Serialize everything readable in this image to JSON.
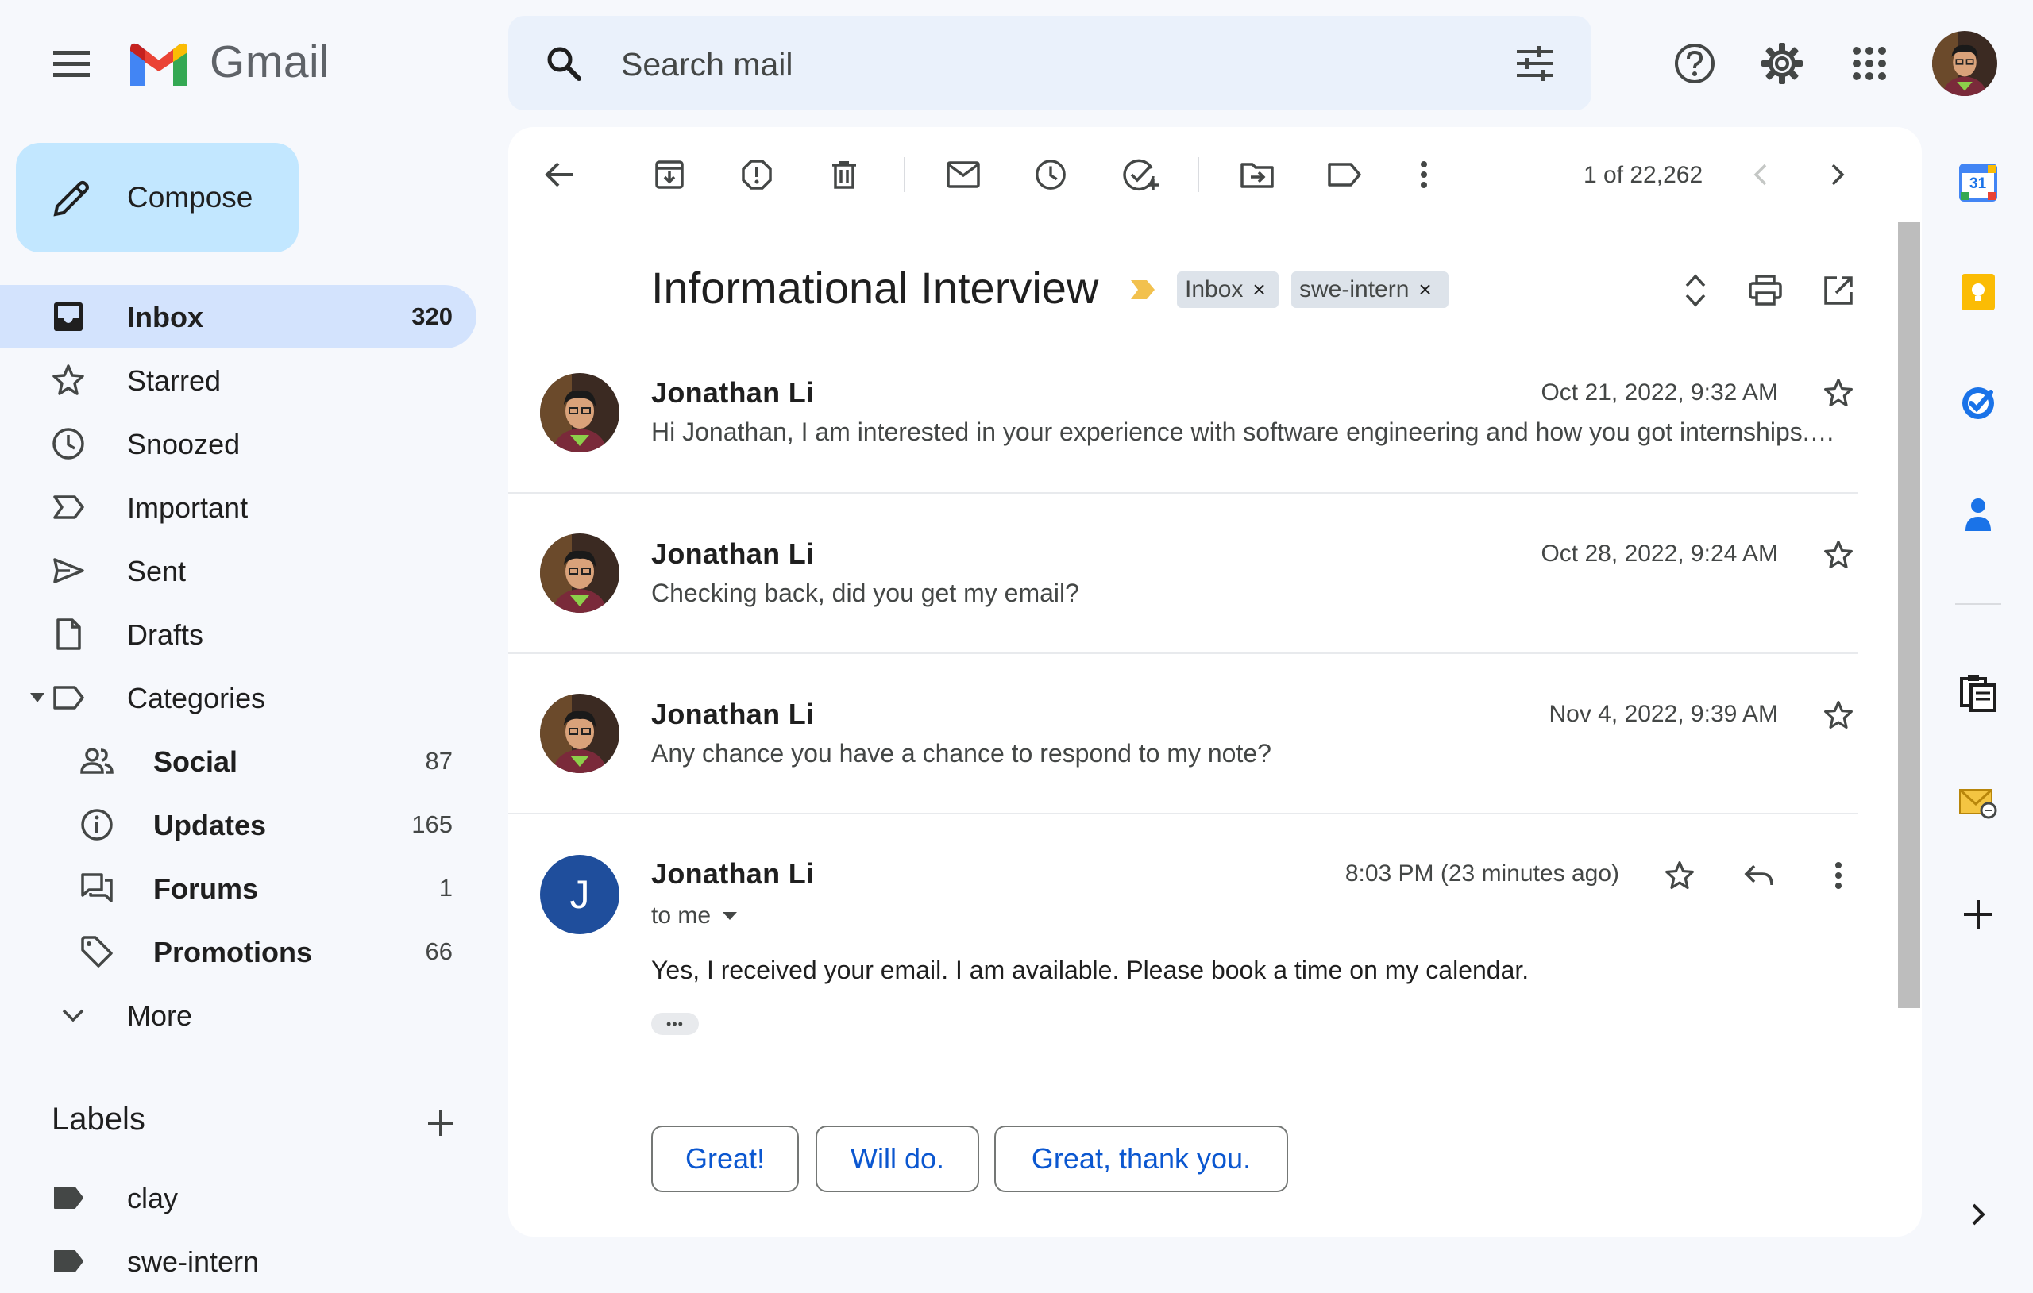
{
  "app": {
    "name": "Gmail"
  },
  "search": {
    "placeholder": "Search mail"
  },
  "compose": {
    "label": "Compose"
  },
  "sidebar": {
    "items": [
      {
        "name": "inbox",
        "label": "Inbox",
        "count": "320"
      },
      {
        "name": "starred",
        "label": "Starred",
        "count": ""
      },
      {
        "name": "snoozed",
        "label": "Snoozed",
        "count": ""
      },
      {
        "name": "important",
        "label": "Important",
        "count": ""
      },
      {
        "name": "sent",
        "label": "Sent",
        "count": ""
      },
      {
        "name": "drafts",
        "label": "Drafts",
        "count": ""
      },
      {
        "name": "categories",
        "label": "Categories",
        "count": ""
      }
    ],
    "categories": [
      {
        "name": "social",
        "label": "Social",
        "count": "87"
      },
      {
        "name": "updates",
        "label": "Updates",
        "count": "165"
      },
      {
        "name": "forums",
        "label": "Forums",
        "count": "1"
      },
      {
        "name": "promotions",
        "label": "Promotions",
        "count": "66"
      }
    ],
    "more_label": "More",
    "labels_title": "Labels",
    "labels": [
      {
        "name": "clay",
        "label": "clay"
      },
      {
        "name": "swe-intern",
        "label": "swe-intern"
      }
    ]
  },
  "toolbar": {
    "pagination": "1 of 22,262"
  },
  "thread": {
    "subject": "Informational Interview",
    "chips": [
      {
        "label": "Inbox",
        "close": "×"
      },
      {
        "label": "swe-intern",
        "close": "×"
      }
    ],
    "messages": [
      {
        "sender": "Jonathan Li",
        "date": "Oct 21, 2022, 9:32 AM",
        "snippet": "Hi Jonathan, I am interested in your experience with software engineering and how you got internships.…"
      },
      {
        "sender": "Jonathan Li",
        "date": "Oct 28, 2022, 9:24 AM",
        "snippet": "Checking back, did you get my email?"
      },
      {
        "sender": "Jonathan Li",
        "date": "Nov 4, 2022, 9:39 AM",
        "snippet": "Any chance you have a chance to respond to my note?"
      }
    ],
    "expanded": {
      "sender": "Jonathan Li",
      "avatar_letter": "J",
      "date": "8:03 PM (23 minutes ago)",
      "to": "to me",
      "body": "Yes, I received your email. I am available. Please book a time on my calendar.",
      "ellipsis": "•••"
    },
    "smart_replies": [
      "Great!",
      "Will do.",
      "Great, thank you."
    ]
  },
  "rail": {
    "calendar_day": "31"
  },
  "colors": {
    "accent": "#0b57d0",
    "compose_bg": "#c2e7ff",
    "active_nav": "#d3e3fd",
    "important_marker": "#f2c14e",
    "avatar_blue": "#1f4e9c"
  }
}
